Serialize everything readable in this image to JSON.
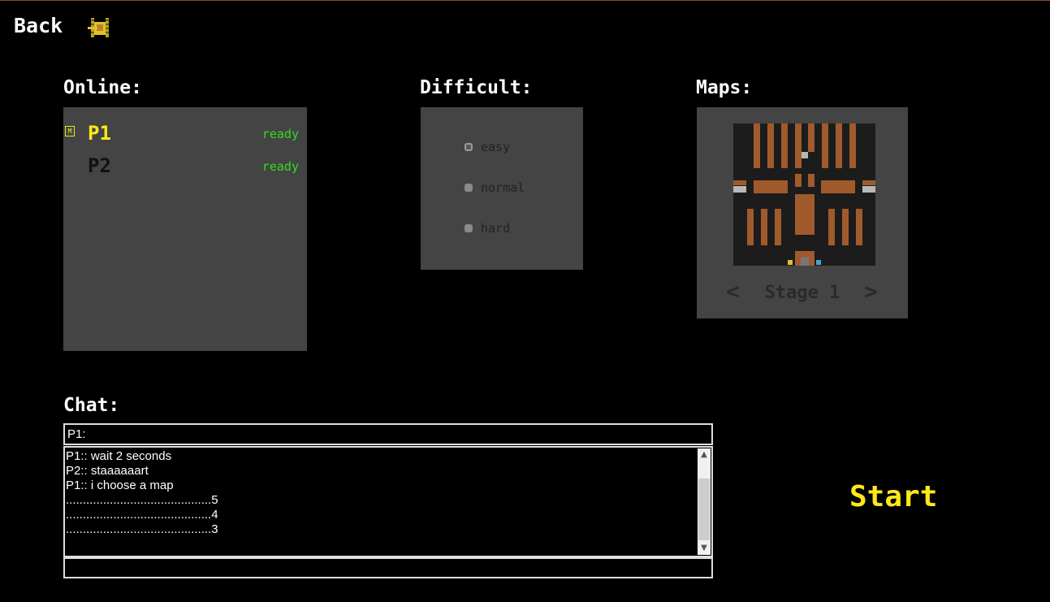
{
  "header": {
    "back_label": "Back",
    "tank_icon": "tank-icon"
  },
  "online": {
    "label": "Online:",
    "players": [
      {
        "name": "P1",
        "status": "ready",
        "is_master": true,
        "master_badge": "M",
        "name_color": "#ffe81a"
      },
      {
        "name": "P2",
        "status": "ready",
        "is_master": false,
        "name_color": "#111111"
      }
    ]
  },
  "difficulty": {
    "label": "Difficult:",
    "options": [
      {
        "label": "easy",
        "selected": true
      },
      {
        "label": "normal",
        "selected": false
      },
      {
        "label": "hard",
        "selected": false
      }
    ]
  },
  "maps": {
    "label": "Maps:",
    "stage_label": "Stage 1",
    "prev_icon": "chevron-left-icon",
    "next_icon": "chevron-right-icon"
  },
  "chat": {
    "label": "Chat:",
    "input_value": "P1:",
    "messages": [
      "P1:: wait 2 seconds",
      "P2:: staaaaaart",
      "P1:: i choose a map",
      "...........................................5",
      "...........................................4",
      "...........................................3"
    ],
    "scroll_up_icon": "scroll-up-icon",
    "scroll_down_icon": "scroll-down-icon"
  },
  "start_label": "Start",
  "colors": {
    "accent_yellow": "#ffe81a",
    "ready_green": "#2fdc1f",
    "panel_gray": "#444444",
    "brick": "#a05a2c"
  }
}
